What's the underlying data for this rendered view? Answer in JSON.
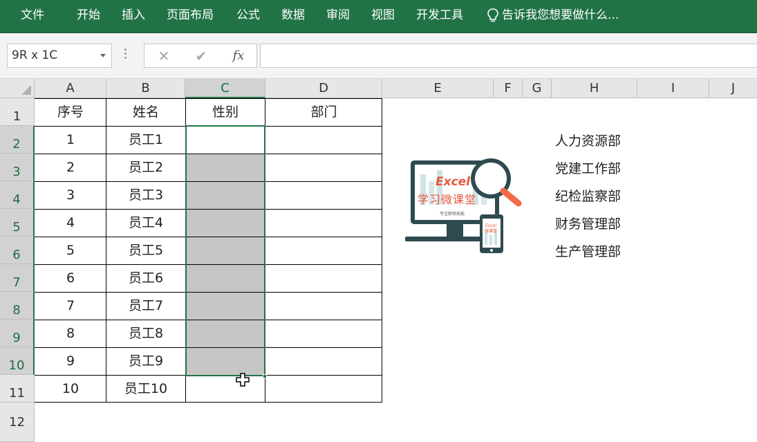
{
  "ribbon": {
    "tabs": [
      "文件",
      "开始",
      "插入",
      "页面布局",
      "公式",
      "数据",
      "审阅",
      "视图",
      "开发工具"
    ],
    "tell_me": "告诉我您想要做什么..."
  },
  "formula_bar": {
    "name_box": "9R x 1C",
    "cancel_glyph": "✕",
    "enter_glyph": "✔",
    "fx_label": "fx",
    "formula": ""
  },
  "columns": [
    "A",
    "B",
    "C",
    "D",
    "E",
    "F",
    "G",
    "H",
    "I",
    "J"
  ],
  "rows": [
    "1",
    "2",
    "3",
    "4",
    "5",
    "6",
    "7",
    "8",
    "9",
    "10",
    "11",
    "12"
  ],
  "table": {
    "headers": [
      "序号",
      "姓名",
      "性别",
      "部门"
    ],
    "rows": [
      [
        "1",
        "员工1"
      ],
      [
        "2",
        "员工2"
      ],
      [
        "3",
        "员工3"
      ],
      [
        "4",
        "员工4"
      ],
      [
        "5",
        "员工5"
      ],
      [
        "6",
        "员工6"
      ],
      [
        "7",
        "员工7"
      ],
      [
        "8",
        "员工8"
      ],
      [
        "9",
        "员工9"
      ],
      [
        "10",
        "员工10"
      ]
    ]
  },
  "departments": [
    "人力资源部",
    "党建工作部",
    "纪检监察部",
    "财务管理部",
    "生产管理部"
  ],
  "logo": {
    "title": "Excel",
    "subtitle": "学习微课堂",
    "tag": "专注职场技能",
    "phone_title": "Excel",
    "phone_subtitle": "微课堂"
  },
  "colors": {
    "accent": "#217346",
    "selection": "#c6c6c6"
  }
}
